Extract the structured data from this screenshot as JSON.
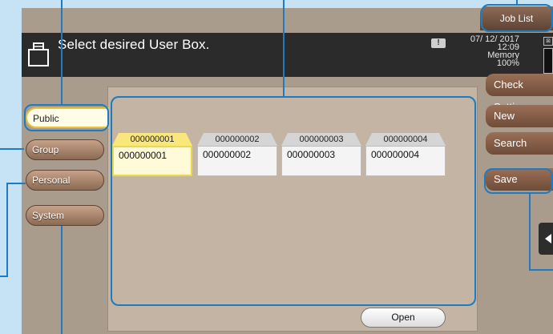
{
  "header": {
    "title": "Select desired User Box.",
    "date": "07/ 12/ 2017",
    "time": "12:09",
    "memory_label": "Memory",
    "memory_value": "100%"
  },
  "right_panel": {
    "job_list": "Job List",
    "check_settings": "Check Setting",
    "new": "New",
    "search": "Search",
    "save": "Save"
  },
  "categories": {
    "public": "Public",
    "group": "Group",
    "personal": "Personal",
    "system": "System"
  },
  "boxes": [
    {
      "tab": "000000001",
      "name": "000000001",
      "selected": true
    },
    {
      "tab": "000000002",
      "name": "000000002",
      "selected": false
    },
    {
      "tab": "000000003",
      "name": "000000003",
      "selected": false
    },
    {
      "tab": "000000004",
      "name": "000000004",
      "selected": false
    }
  ],
  "open_button": "Open",
  "colors": {
    "callout": "#1f7bc1",
    "panel_bg": "#a99c8d",
    "header_bg": "#2b2b2b",
    "selected_tab": "#e7c23a"
  }
}
